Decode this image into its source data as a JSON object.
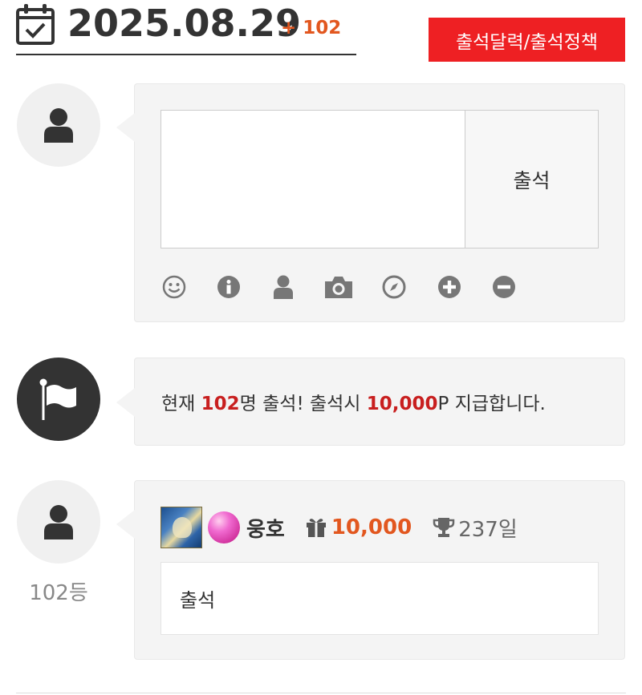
{
  "header": {
    "date": "2025.08.29",
    "plus_count": "+ 102",
    "policy_button": "출석달력/출석정책"
  },
  "write": {
    "placeholder": "",
    "submit_label": "출석",
    "tools": [
      "smile-icon",
      "info-icon",
      "user-icon",
      "camera-icon",
      "compass-icon",
      "plus-circle-icon",
      "minus-circle-icon"
    ]
  },
  "notice": {
    "prefix": "현재 ",
    "count": "102",
    "middle": "명 출석! 출석시 ",
    "points": "10,000",
    "suffix": "P 지급합니다."
  },
  "entry": {
    "nickname": "웅호",
    "points": "10,000",
    "days": "237일",
    "message": "출석",
    "rank": "102등"
  },
  "colors": {
    "accent_red": "#ee2023",
    "points_orange": "#e2571f",
    "notice_red": "#c81f1f",
    "panel_bg": "#f4f4f4"
  }
}
